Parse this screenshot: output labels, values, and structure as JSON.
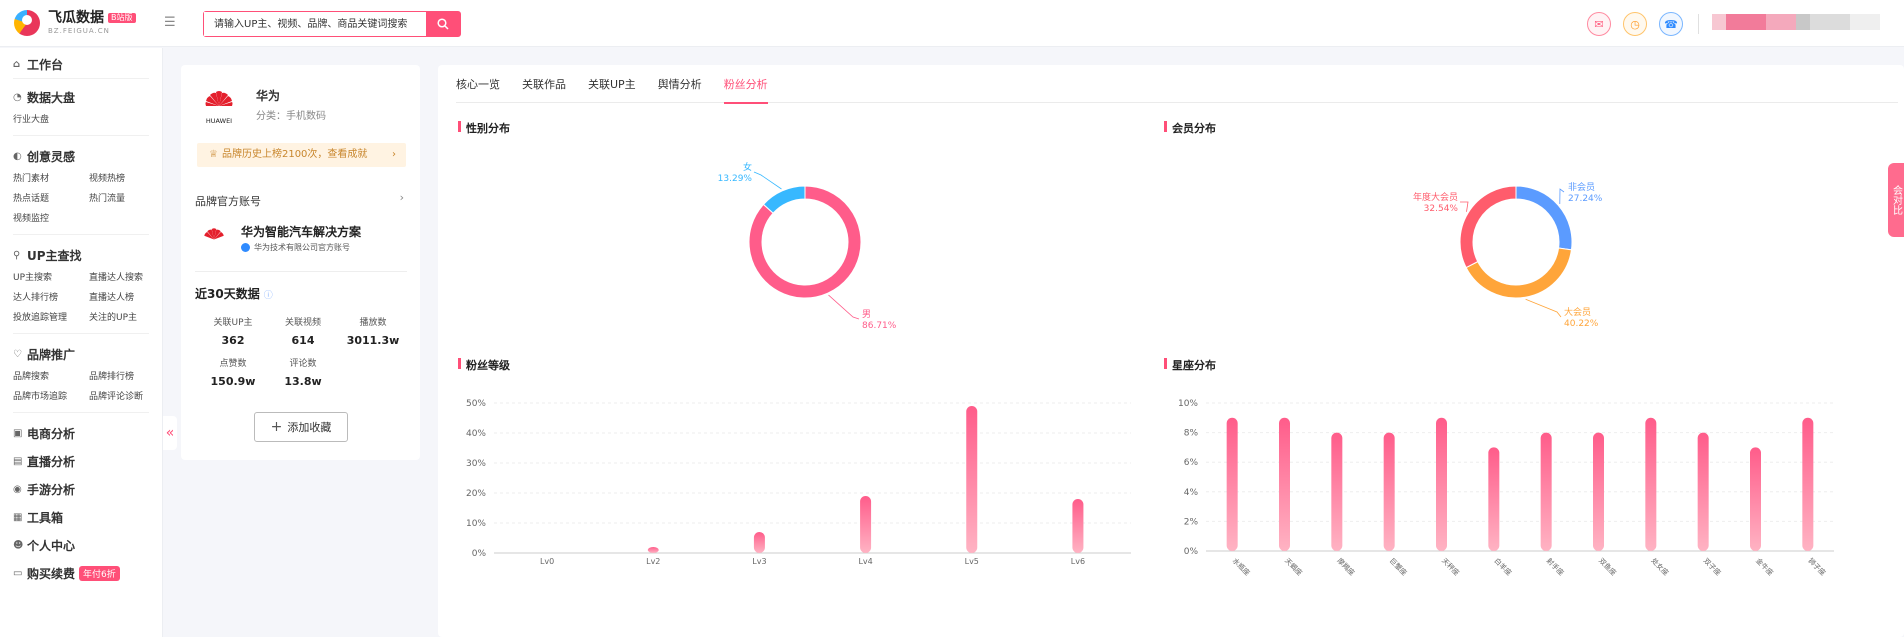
{
  "header": {
    "logo_title": "飞瓜数据",
    "logo_badge": "B站版",
    "logo_sub": "BZ.FEIGUA.CN",
    "search_placeholder": "请输入UP主、视频、品牌、商品关键词搜索",
    "icons": [
      "menu-icon",
      "search-icon",
      "mail-icon",
      "clock-icon",
      "customer-service-icon"
    ]
  },
  "sidebar": {
    "groups": [
      {
        "label": "工作台",
        "icon": "home-icon",
        "items": []
      },
      {
        "label": "数据大盘",
        "icon": "pie-icon",
        "items": [
          "行业大盘"
        ]
      },
      {
        "label": "创意灵感",
        "icon": "bulb-icon",
        "items": [
          "热门素材",
          "视频热榜",
          "热点话题",
          "热门流量",
          "视频监控"
        ]
      },
      {
        "label": "UP主查找",
        "icon": "search-icon",
        "items": [
          "UP主搜索",
          "直播达人搜索",
          "达人排行榜",
          "直播达人榜",
          "投放追踪管理",
          "关注的UP主"
        ]
      },
      {
        "label": "品牌推广",
        "icon": "heart-icon",
        "items": [
          "品牌搜索",
          "品牌排行榜",
          "品牌市场追踪",
          "品牌评论诊断"
        ]
      },
      {
        "label": "电商分析",
        "icon": "cart-icon",
        "items": []
      },
      {
        "label": "直播分析",
        "icon": "tv-icon",
        "items": []
      },
      {
        "label": "手游分析",
        "icon": "gamepad-icon",
        "items": []
      },
      {
        "label": "工具箱",
        "icon": "toolbox-icon",
        "items": []
      },
      {
        "label": "个人中心",
        "icon": "user-icon",
        "items": []
      },
      {
        "label": "购买续费",
        "icon": "card-icon",
        "items": [],
        "promo": "年付6折"
      }
    ]
  },
  "brand": {
    "name": "华为",
    "logo_text": "HUAWEI",
    "category": "分类：手机数码",
    "banner": "品牌历史上榜2100次，查看成就",
    "official_account_header": "品牌官方账号",
    "account_name": "华为智能汽车解决方案",
    "account_desc": "华为技术有限公司官方账号",
    "stats_title": "近30天数据",
    "stats": [
      {
        "label": "关联UP主",
        "value": "362"
      },
      {
        "label": "关联视频",
        "value": "614"
      },
      {
        "label": "播放数",
        "value": "3011.3w"
      },
      {
        "label": "点赞数",
        "value": "150.9w"
      },
      {
        "label": "评论数",
        "value": "13.8w"
      }
    ],
    "favorite_button": "添加收藏"
  },
  "tabs": [
    {
      "label": "核心一览",
      "active": false
    },
    {
      "label": "关联作品",
      "active": false
    },
    {
      "label": "关联UP主",
      "active": false
    },
    {
      "label": "舆情分析",
      "active": false
    },
    {
      "label": "粉丝分析",
      "active": true
    }
  ],
  "panels": {
    "gender": "性别分布",
    "member": "会员分布",
    "level": "粉丝等级",
    "zodiac": "星座分布"
  },
  "side_float_text": "会对比",
  "chart_data": [
    {
      "type": "pie",
      "title": "性别分布",
      "slices": [
        {
          "label": "男",
          "value": 86.71,
          "display": "86.71%",
          "color": "#ff5c8a"
        },
        {
          "label": "女",
          "value": 13.29,
          "display": "13.29%",
          "color": "#37b8ff"
        }
      ]
    },
    {
      "type": "pie",
      "title": "会员分布",
      "slices": [
        {
          "label": "非会员",
          "value": 27.24,
          "display": "27.24%",
          "color": "#5b9bff"
        },
        {
          "label": "大会员",
          "value": 40.22,
          "display": "40.22%",
          "color": "#ffa53a"
        },
        {
          "label": "年度大会员",
          "value": 32.54,
          "display": "32.54%",
          "color": "#ff5c6c"
        }
      ]
    },
    {
      "type": "bar",
      "title": "粉丝等级",
      "categories": [
        "Lv0",
        "Lv2",
        "Lv3",
        "Lv4",
        "Lv5",
        "Lv6"
      ],
      "values": [
        0,
        2,
        7,
        19,
        49,
        18
      ],
      "yticks": [
        "0%",
        "10%",
        "20%",
        "30%",
        "40%",
        "50%"
      ],
      "ylim": [
        0,
        50
      ]
    },
    {
      "type": "bar",
      "title": "星座分布",
      "categories": [
        "水瓶座",
        "天蝎座",
        "摩羯座",
        "巨蟹座",
        "天秤座",
        "白羊座",
        "射手座",
        "双鱼座",
        "处女座",
        "双子座",
        "金牛座",
        "狮子座"
      ],
      "values": [
        9,
        9,
        8,
        8,
        9,
        7,
        8,
        8,
        9,
        8,
        7,
        9
      ],
      "yticks": [
        "0%",
        "2%",
        "4%",
        "6%",
        "8%",
        "10%"
      ],
      "ylim": [
        0,
        10
      ]
    }
  ]
}
